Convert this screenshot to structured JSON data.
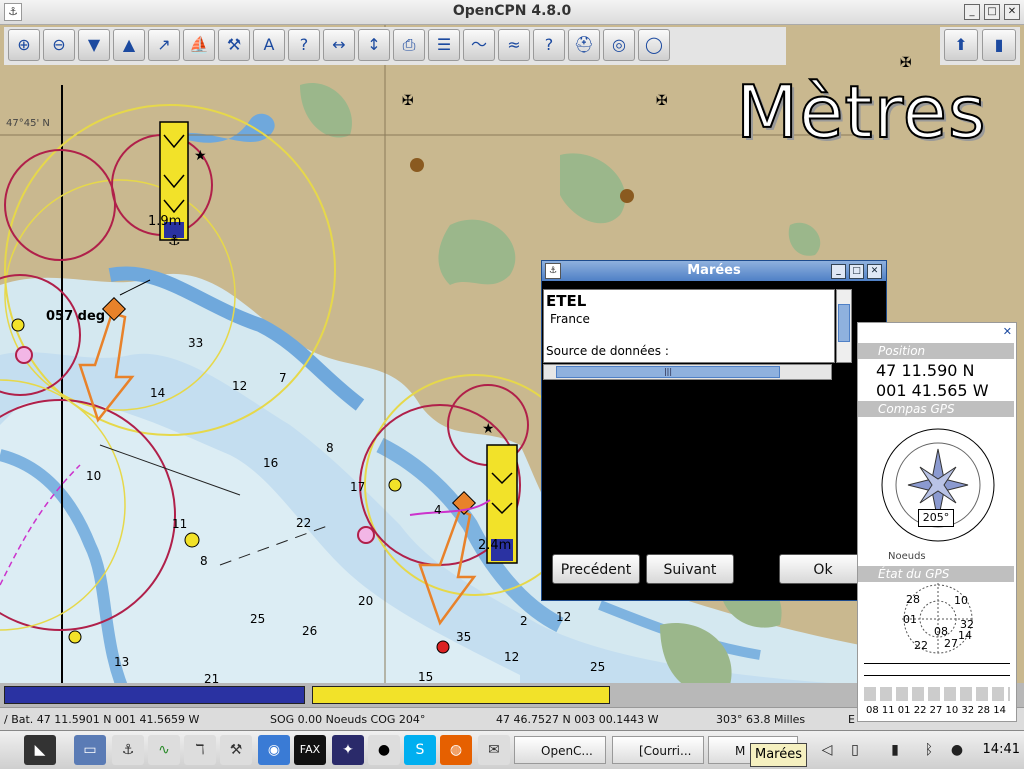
{
  "window": {
    "title": "OpenCPN 4.8.0"
  },
  "toolbar": {
    "tools": [
      {
        "icon": "zoom-in-icon",
        "glyph": "⊕"
      },
      {
        "icon": "zoom-out-icon",
        "glyph": "⊖"
      },
      {
        "icon": "scale-down-icon",
        "glyph": "▼"
      },
      {
        "icon": "scale-up-icon",
        "glyph": "▲"
      },
      {
        "icon": "route-icon",
        "glyph": "↗"
      },
      {
        "icon": "ship-icon",
        "glyph": "⛵"
      },
      {
        "icon": "settings-wrench-icon",
        "glyph": "⚒"
      },
      {
        "icon": "add-text-icon",
        "glyph": "A"
      },
      {
        "icon": "query-icon",
        "glyph": "?"
      },
      {
        "icon": "measure-icon",
        "glyph": "↔"
      },
      {
        "icon": "move-icon",
        "glyph": "↕"
      },
      {
        "icon": "print-icon",
        "glyph": "⎙"
      },
      {
        "icon": "route-manager-icon",
        "glyph": "☰"
      },
      {
        "icon": "track-icon",
        "glyph": "〜"
      },
      {
        "icon": "tide-icon",
        "glyph": "≈"
      },
      {
        "icon": "help-icon",
        "glyph": "?"
      },
      {
        "icon": "mob-icon",
        "glyph": "⛑"
      },
      {
        "icon": "ais-icon",
        "glyph": "◎"
      },
      {
        "icon": "lifebuoy-icon",
        "glyph": "◯"
      }
    ]
  },
  "toolbar_right": {
    "tools": [
      {
        "icon": "compass-icon",
        "glyph": "⬆"
      },
      {
        "icon": "gps-signal-icon",
        "glyph": "▮"
      }
    ]
  },
  "map": {
    "units_watermark": "Mètres",
    "lat_label": "47°45' N",
    "depth_left": "1.9m",
    "depth_right": "2.4m",
    "bearing_label": "057 deg",
    "soundings": [
      "33",
      "14",
      "12",
      "16",
      "10",
      "11",
      "8",
      "22",
      "17",
      "20",
      "25",
      "26",
      "13",
      "21",
      "15",
      "13",
      "35",
      "4",
      "7",
      "8",
      "12",
      "25",
      "2",
      "12"
    ]
  },
  "tide_bars": {
    "blue_label": "",
    "yellow_label": ""
  },
  "status": {
    "boat_position": "/ Bat. 47 11.5901 N   001 41.5659 W",
    "sog_cog": "SOG 0.00 Noeuds  COG 204°",
    "cursor_position": "47 46.7527 N   003 00.1443 W",
    "bearing_range": "303°  63.8 Milles",
    "scale": "E"
  },
  "dialog": {
    "title": "Marées",
    "station": "ETEL",
    "country": "France",
    "source_label": "Source de données :",
    "prev_label": "Precédent",
    "next_label": "Suivant",
    "ok_label": "Ok"
  },
  "dashboard": {
    "position_header": "Position",
    "lat": "47 11.590 N",
    "lon": "001 41.565 W",
    "compass_header": "Compas GPS",
    "compass_heading": "205°",
    "sog_unit": "Noeuds",
    "satellites_header": "État du GPS",
    "sat_ids_plot": [
      "28",
      "10",
      "01",
      "32",
      "14",
      "08",
      "22",
      "27"
    ],
    "sat_ids_bar": "08 11 01 22 27 10 32 28 14"
  },
  "taskbar": {
    "tasks": [
      {
        "label": "OpenC...",
        "icon": "opencpn-icon"
      },
      {
        "label": "[Courri...",
        "icon": "mail-icon"
      },
      {
        "label": "M",
        "icon": "opencpn-icon"
      }
    ],
    "tooltip": "Marées",
    "clock": "14:41"
  }
}
